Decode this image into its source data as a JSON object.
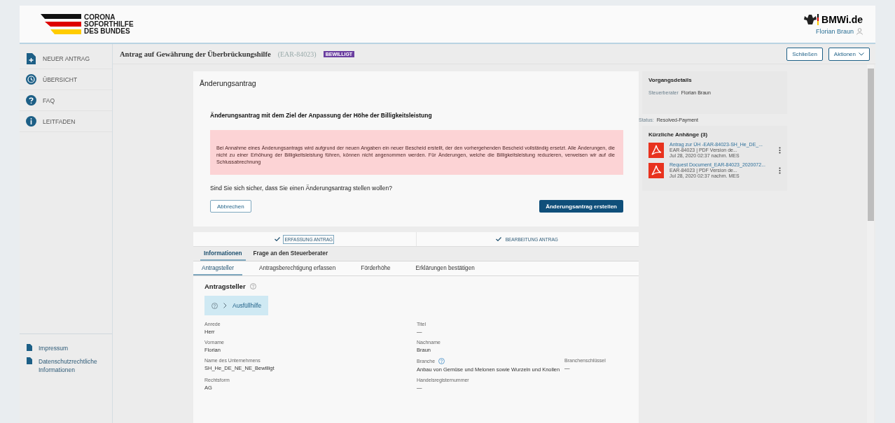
{
  "header": {
    "logo_lines": [
      "CORONA",
      "SOFORTHILFE",
      "DES BUNDES"
    ],
    "ministry": "BMWi.de",
    "user": "Florian Braun"
  },
  "sidebar": {
    "items": [
      {
        "label": "NEUER ANTRAG",
        "kind": "new"
      },
      {
        "label": "ÜBERSICHT",
        "kind": "overview"
      },
      {
        "label": "FAQ",
        "kind": "faq"
      },
      {
        "label": "LEITFADEN",
        "kind": "guide"
      }
    ],
    "footer_links": [
      "Impressum",
      "Datenschutzrechtliche Informationen"
    ]
  },
  "case": {
    "title": "Antrag auf Gewährung der Überbrückungshilfe",
    "id": "(EAR-84023)",
    "badge": "BEWILLIGT",
    "buttons": [
      {
        "label": "Schließen",
        "kind": "plain"
      },
      {
        "label": "Aktionen",
        "kind": "menu"
      }
    ]
  },
  "dialog": {
    "title": "Änderungsantrag",
    "heading": "Änderungsantrag mit dem Ziel der Anpassung der Höhe der Billigkeitsleistung",
    "warning": "Bei Annahme eines Änderungsantrags wird aufgrund der neuen Angaben ein neuer Bescheid erstellt, der den vorhergehenden Bescheid vollständig ersetzt. Alle Änderungen, die nicht zu einer Erhöhung der Billigkeitsleistung führen, können nicht angenommen werden. Für Änderungen, welche die Billigkeitsleistung reduzieren, verweisen wir auf die Schlussabrechnung",
    "question": "Sind Sie sich sicher, dass Sie einen Änderungsantrag stellen wollen?",
    "cancel": "Abbrechen",
    "confirm": "Änderungsantrag erstellen"
  },
  "steps": [
    {
      "label": "ERFASSUNG ANTRAG",
      "done": true,
      "selected": true
    },
    {
      "label": "BEARBEITUNG ANTRAG",
      "done": true,
      "selected": false
    }
  ],
  "tabs": [
    {
      "label": "Informationen",
      "selected": true
    },
    {
      "label": "Frage an den Steuerberater",
      "selected": false
    }
  ],
  "subtabs": [
    {
      "label": "Antragsteller",
      "selected": true
    },
    {
      "label": "Antragsberechtigung erfassen",
      "selected": false
    },
    {
      "label": "Förderhöhe",
      "selected": false
    },
    {
      "label": "Erklärungen bestätigen",
      "selected": false
    }
  ],
  "section": {
    "title": "Antragsteller",
    "help": "Ausfüllhilfe",
    "rows": [
      [
        {
          "label": "Anrede",
          "value": "Herr",
          "help": false
        },
        {
          "label": "Titel",
          "value": "—",
          "help": false
        }
      ],
      [
        {
          "label": "Vorname",
          "value": "Florian",
          "help": false
        },
        {
          "label": "Nachname",
          "value": "Braun",
          "help": false
        }
      ],
      [
        {
          "label": "Name des Unternehmens",
          "value": "SH_He_DE_NE_NE_Bewilligt",
          "help": false
        },
        {
          "label": "Branche",
          "value": "Anbau von Gemüse und Melonen sowie Wurzeln und Knollen",
          "help": true
        },
        {
          "label": "Branchenschlüssel",
          "value": "—",
          "help": false
        }
      ],
      [
        {
          "label": "Rechtsform",
          "value": "AG",
          "help": false
        },
        {
          "label": "Handelsregisternummer",
          "value": "—",
          "help": false
        }
      ]
    ]
  },
  "details": {
    "title": "Vorgangsdetails",
    "rows": [
      {
        "label": "Steuerberater",
        "value": "Florian Braun"
      }
    ],
    "status_label": "Status:",
    "status": "Resolved-Payment",
    "attachments_title": "Kürzliche Anhänge (3)",
    "attachments": [
      {
        "name": "Antrag zur ÜH -EAR-84023-SH_He_DE_...",
        "meta": "EAR-84023 | PDF Version de...",
        "date": "Jul 28, 2020 02:37 nachm. MES"
      },
      {
        "name": "Request Document_EAR-84023_2020072...",
        "meta": "EAR-84023 | PDF Version de...",
        "date": "Jul 28, 2020 02:37 nachm. MES"
      }
    ]
  }
}
